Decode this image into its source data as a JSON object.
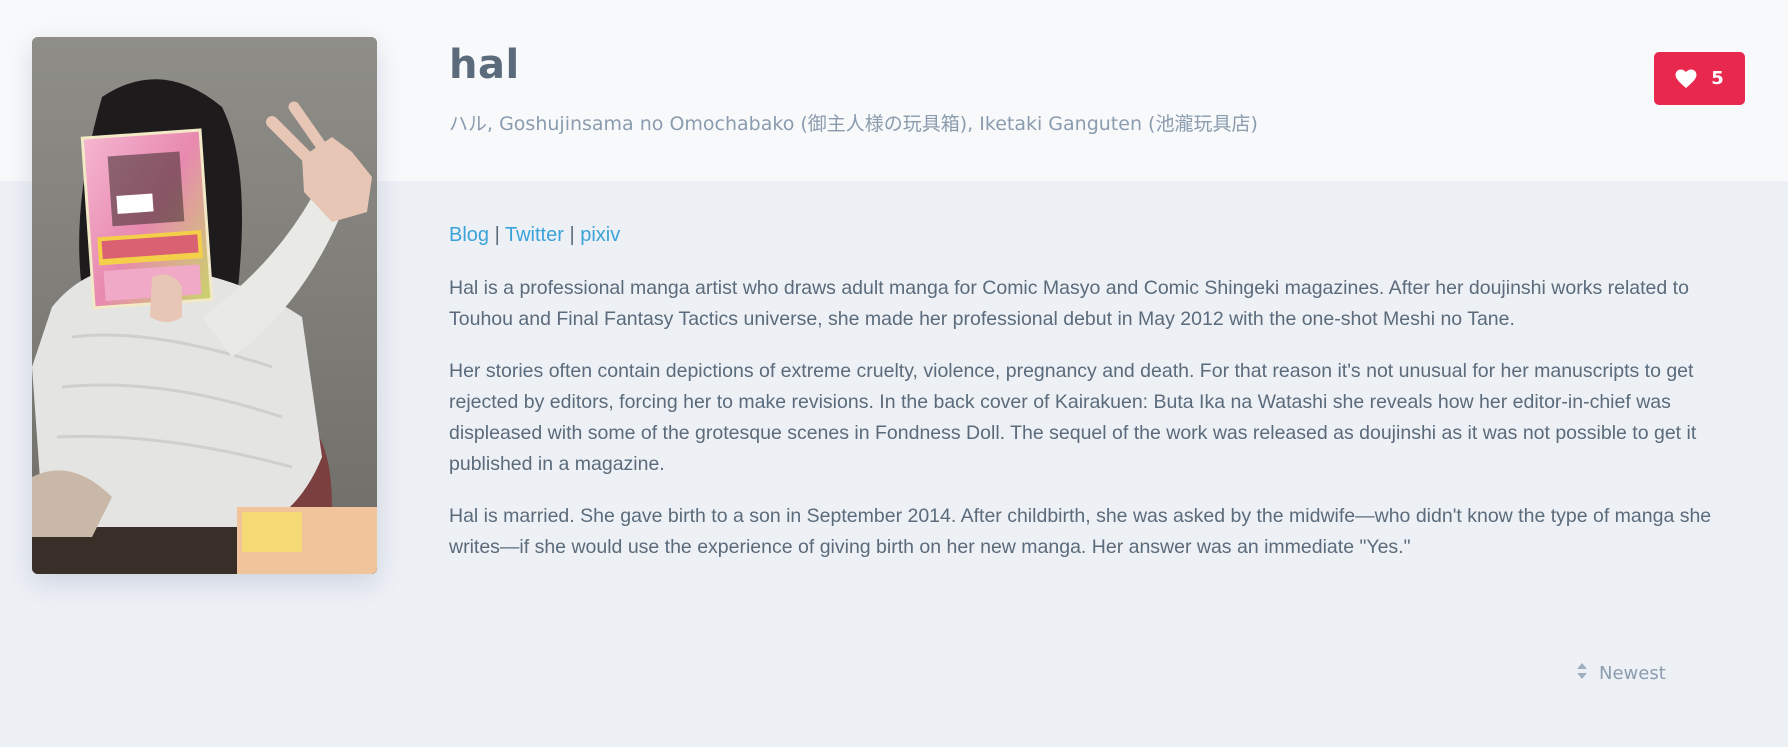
{
  "profile": {
    "name": "hal",
    "aliases": "ハル, Goshujinsama no Omochabako (御主人様の玩具箱), Iketaki Ganguten (池瀧玩具店)",
    "favorite_count": "5",
    "favorite_icon": "heart-icon",
    "photo_description_icon": "profile-photo"
  },
  "links": {
    "blog": "Blog",
    "twitter": "Twitter",
    "pixiv": "pixiv",
    "separator": "|"
  },
  "bio": {
    "paragraphs": [
      "Hal is a professional manga artist who draws adult manga for Comic Masyo and Comic Shingeki magazines. After her doujinshi works related to Touhou and Final Fantasy Tactics universe, she made her professional debut in May 2012 with the one-shot Meshi no Tane.",
      "Her stories often contain depictions of extreme cruelty, violence, pregnancy and death. For that reason it's not unusual for her manuscripts to get rejected by editors, forcing her to make revisions. In the back cover of Kairakuen: Buta Ika na Watashi she reveals how her editor-in-chief was displeased with some of the grotesque scenes in Fondness Doll. The sequel of the work was released as doujinshi as it was not possible to get it published in a magazine.",
      "Hal is married. She gave birth to a son in September 2014. After childbirth, she was asked by the midwife—who didn't know the type of manga she writes—if she would use the experience of giving birth on her new manga. Her answer was an immediate \"Yes.\""
    ]
  },
  "sort": {
    "label": "Newest",
    "icon": "sort-icon"
  },
  "colors": {
    "accent": "#e8294d",
    "link": "#3aa3d9",
    "text": "#5b6b7b",
    "muted": "#8a9cae",
    "background": "#edf0f5",
    "header_background": "#f8f9fb"
  }
}
